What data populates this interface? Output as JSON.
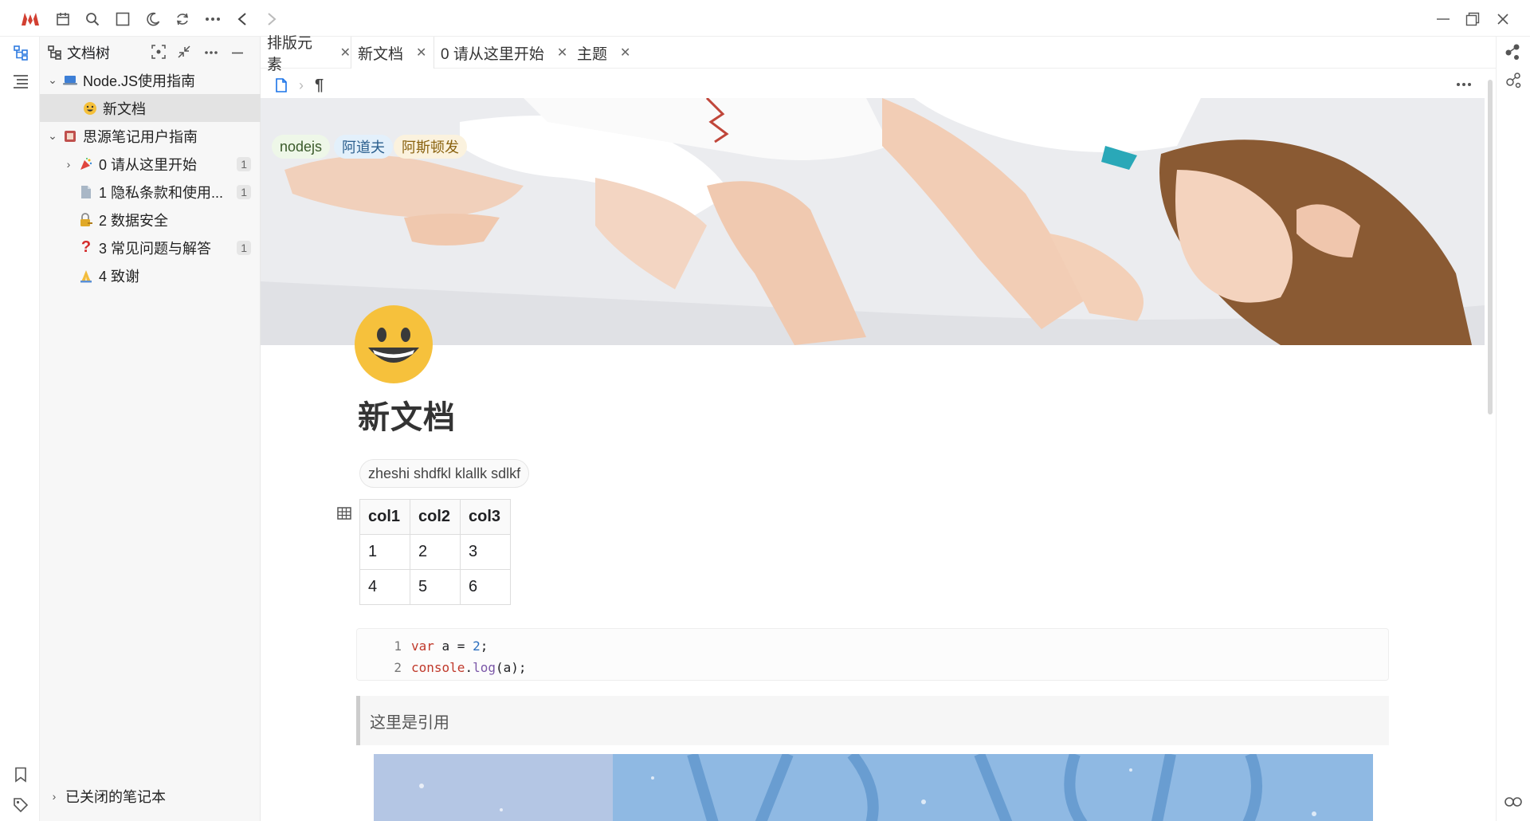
{
  "toolbar": {
    "icons": [
      "siyuan-logo",
      "calendar-icon",
      "search-icon",
      "square-icon",
      "moon-icon",
      "sync-icon",
      "more-icon",
      "back-icon",
      "forward-icon"
    ]
  },
  "window_controls": [
    "minimize",
    "restore",
    "close"
  ],
  "tree": {
    "title": "文档树",
    "items": [
      {
        "label": "Node.JS使用指南",
        "depth": 0,
        "expanded": true
      },
      {
        "label": "新文档",
        "depth": 1,
        "selected": true
      },
      {
        "label": "思源笔记用户指南",
        "depth": 0,
        "expanded": true
      },
      {
        "label": "0 请从这里开始",
        "depth": 1,
        "count": "1"
      },
      {
        "label": "1 隐私条款和使用...",
        "depth": 1,
        "count": "1"
      },
      {
        "label": "2 数据安全",
        "depth": 1
      },
      {
        "label": "3 常见问题与解答",
        "depth": 1,
        "count": "1"
      },
      {
        "label": "4 致谢",
        "depth": 1
      }
    ],
    "closed_notebooks": "已关闭的笔记本"
  },
  "tabs": [
    {
      "label": "排版元素"
    },
    {
      "label": "新文档",
      "active": true
    },
    {
      "label": "0 请从这里开始"
    },
    {
      "label": "主题"
    }
  ],
  "doc": {
    "tags": [
      {
        "label": "nodejs",
        "bg": "#eef7e8"
      },
      {
        "label": "阿道夫",
        "bg": "#e3f0fb"
      },
      {
        "label": "阿斯顿发",
        "bg": "#fbf2de"
      }
    ],
    "title": "新文档",
    "subtitle": "zheshi shdfkl klallk sdlkf",
    "table": {
      "headers": [
        "col1",
        "col2",
        "col3"
      ],
      "rows": [
        [
          "1",
          "2",
          "3"
        ],
        [
          "4",
          "5",
          "6"
        ]
      ]
    },
    "code": [
      {
        "n": "1",
        "tokens": [
          {
            "t": "var",
            "c": "kw"
          },
          {
            "t": " a = ",
            "c": "p"
          },
          {
            "t": "2",
            "c": "num"
          },
          {
            "t": ";",
            "c": "p"
          }
        ]
      },
      {
        "n": "2",
        "tokens": [
          {
            "t": "console",
            "c": "obj"
          },
          {
            "t": ".",
            "c": "p"
          },
          {
            "t": "log",
            "c": "fn"
          },
          {
            "t": "(a);",
            "c": "p"
          }
        ]
      }
    ],
    "quote": "这里是引用"
  },
  "colors": {
    "kw": "#c0392b",
    "num": "#2c6fbf",
    "obj": "#c0392b",
    "fn": "#7b57a8",
    "p": "#222222"
  }
}
